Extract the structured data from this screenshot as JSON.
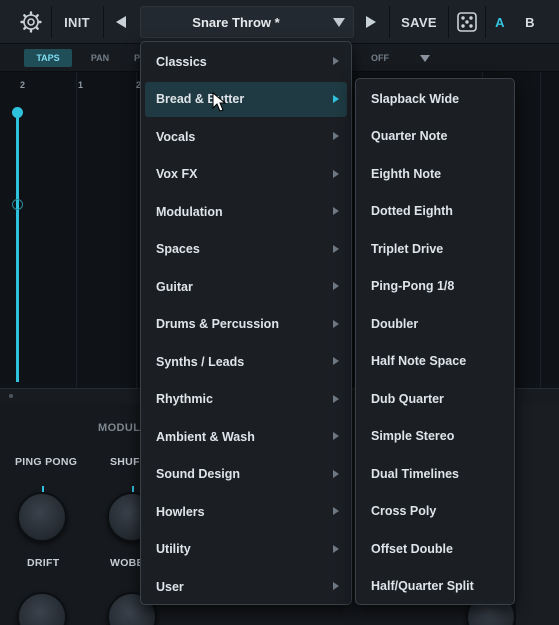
{
  "topbar": {
    "gear_icon": "gear-icon",
    "init_label": "INIT",
    "prev_icon": "triangle-left-icon",
    "preset_name": "Snare Throw *",
    "preset_caret_icon": "caret-down-icon",
    "next_icon": "triangle-right-icon",
    "save_label": "SAVE",
    "dice_icon": "dice-icon",
    "a_label": "A",
    "b_label": "B"
  },
  "tabs": {
    "taps": "TAPS",
    "pan": "PAN",
    "p": "P",
    "off": "OFF"
  },
  "ruler": [
    "2",
    "1",
    "2"
  ],
  "modulation": {
    "title": "MODULA",
    "knobs": [
      {
        "label": "PING PONG"
      },
      {
        "label": "SHUF"
      },
      {
        "label": "DRIFT"
      },
      {
        "label": "WOBB"
      }
    ]
  },
  "menu": {
    "categories": [
      "Classics",
      "Bread & Butter",
      "Vocals",
      "Vox FX",
      "Modulation",
      "Spaces",
      "Guitar",
      "Drums & Percussion",
      "Synths / Leads",
      "Rhythmic",
      "Ambient & Wash",
      "Sound Design",
      "Howlers",
      "Utility",
      "User"
    ],
    "highlighted": "Bread & Butter",
    "submenu": [
      "Slapback Wide",
      "Quarter Note",
      "Eighth Note",
      "Dotted Eighth",
      "Triplet Drive",
      "Ping-Pong 1/8",
      "Doubler",
      "Half Note Space",
      "Dub Quarter",
      "Simple Stereo",
      "Dual Timelines",
      "Cross Poly",
      "Offset Double",
      "Half/Quarter Split"
    ]
  },
  "colors": {
    "accent": "#2fc2dc",
    "background": "#14181d",
    "menu_bg": "#1b1f24",
    "highlight": "#1f3a42"
  }
}
